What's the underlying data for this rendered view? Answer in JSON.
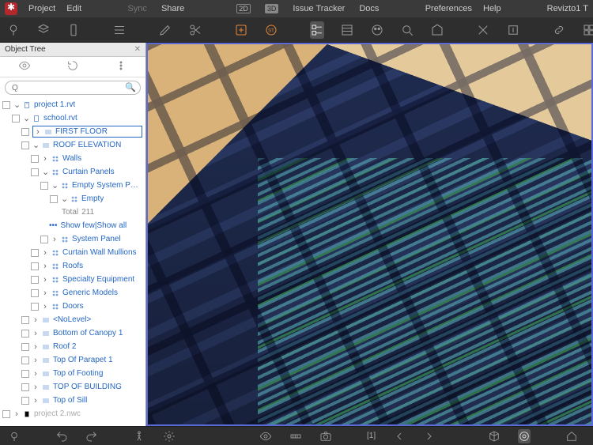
{
  "menubar": {
    "left": [
      "Project",
      "Edit"
    ],
    "center": {
      "sync": "Sync",
      "share": "Share",
      "view2d": "2D",
      "view3d": "3D",
      "issueTracker": "Issue Tracker",
      "docs": "Docs"
    },
    "right": {
      "preferences": "Preferences",
      "help": "Help",
      "user": "Revizto1 T"
    }
  },
  "panel": {
    "title": "Object Tree",
    "search_placeholder": "Q"
  },
  "tree": {
    "project": "project 1.rvt",
    "school": "school.rvt",
    "first_floor": "FIRST FLOOR",
    "roof_elev": "ROOF ELEVATION",
    "walls": "Walls",
    "curtain_panels": "Curtain Panels",
    "empty_panel": "Empty System Panel",
    "empty": "Empty",
    "total_label": "Total",
    "total_count": "211",
    "show_few": "Show few",
    "show_all": "Show all",
    "dots": "•••",
    "sep": " | ",
    "system_panel": "System Panel",
    "curtain_mullions": "Curtain Wall Mullions",
    "roofs": "Roofs",
    "specialty": "Specialty Equipment",
    "generic": "Generic Models",
    "doors": "Doors",
    "nolevel": "<NoLevel>",
    "bottom_canopy": "Bottom of Canopy 1",
    "roof2": "Roof 2",
    "parapet": "Top Of Parapet 1",
    "footing": "Top of Footing",
    "top_building": "TOP OF BUILDING",
    "top_sill": "Top of Sill",
    "project2": "project 2.nwc"
  },
  "bottombar": {
    "viewpoint": "[1]"
  }
}
